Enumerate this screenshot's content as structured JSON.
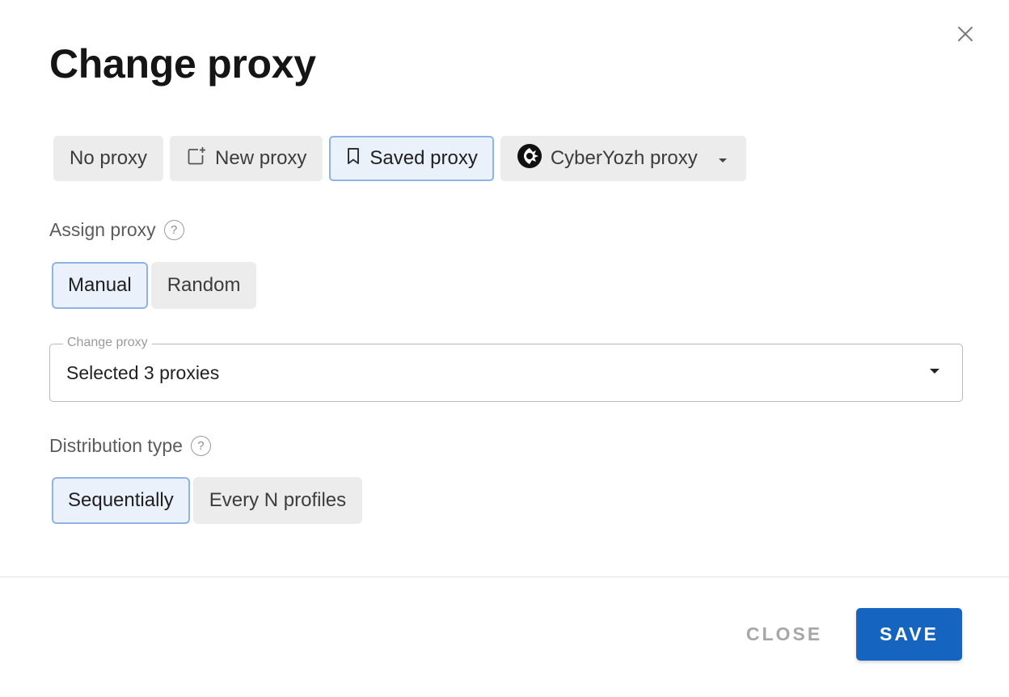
{
  "dialog": {
    "title": "Change proxy",
    "close_icon": "close-icon"
  },
  "proxy_tabs": {
    "no_proxy": "No proxy",
    "new_proxy": "New proxy",
    "saved_proxy": "Saved proxy",
    "cyberyozh_proxy": "CyberYozh proxy",
    "selected": "Saved proxy"
  },
  "assign": {
    "label": "Assign proxy",
    "options": [
      "Manual",
      "Random"
    ],
    "selected": "Manual"
  },
  "change_proxy_select": {
    "legend": "Change proxy",
    "value": "Selected 3 proxies"
  },
  "distribution": {
    "label": "Distribution type",
    "options": [
      "Sequentially",
      "Every N profiles"
    ],
    "selected": "Sequentially"
  },
  "footer": {
    "close_label": "CLOSE",
    "save_label": "SAVE"
  },
  "colors": {
    "accent": "#1565c0",
    "active_bg": "#eaf1fb",
    "active_border": "#8fb3e6",
    "inactive_bg": "#ececec"
  }
}
